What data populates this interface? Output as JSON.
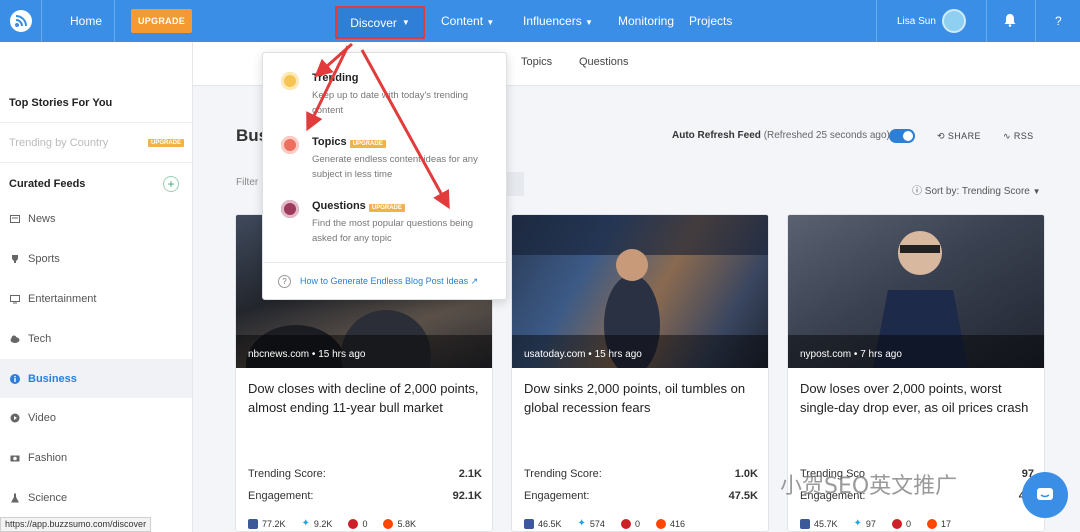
{
  "topnav": {
    "home": "Home",
    "upgrade": "UPGRADE",
    "discover": "Discover",
    "content": "Content",
    "influencers": "Influencers",
    "monitoring": "Monitoring",
    "projects": "Projects",
    "user_name": "Lisa Sun",
    "help": "?",
    "icons": [
      "buzzsumo-logo-icon",
      "chevron-down-icon",
      "avatar",
      "bell-icon",
      "help-icon"
    ]
  },
  "subnav": {
    "tabs": [
      "Topics",
      "Questions"
    ]
  },
  "sidebar": {
    "top_stories": "Top Stories For You",
    "trending_by_country": "Trending by Country",
    "upgrade_badge": "UPGRADE",
    "curated_feeds": "Curated Feeds",
    "add": "+",
    "items": [
      {
        "label": "News",
        "icon": "newspaper-icon"
      },
      {
        "label": "Sports",
        "icon": "trophy-icon"
      },
      {
        "label": "Entertainment",
        "icon": "tv-icon"
      },
      {
        "label": "Tech",
        "icon": "cloud-icon"
      },
      {
        "label": "Business",
        "icon": "info-icon",
        "active": true
      },
      {
        "label": "Video",
        "icon": "play-icon"
      },
      {
        "label": "Fashion",
        "icon": "camera-icon"
      },
      {
        "label": "Science",
        "icon": "flask-icon"
      }
    ]
  },
  "main": {
    "title": "Bus",
    "filter_label": "Filter",
    "auto_refresh_label": "Auto Refresh Feed",
    "refreshed": "(Refreshed 25 seconds ago)",
    "share": "SHARE",
    "rss": "RSS",
    "sort_by": "Sort by: Trending Score"
  },
  "cards": [
    {
      "source": "nbcnews.com • 15 hrs ago",
      "title": "Dow closes with decline of 2,000 points, almost ending 11-year bull market",
      "trending_label": "Trending Score:",
      "trending": "2.1K",
      "engagement_label": "Engagement:",
      "engagement": "92.1K",
      "facebook": "77.2K",
      "twitter": "9.2K",
      "pinterest": "0",
      "reddit": "5.8K"
    },
    {
      "source": "usatoday.com • 15 hrs ago",
      "title": "Dow sinks 2,000 points, oil tumbles on global recession fears",
      "trending_label": "Trending Score:",
      "trending": "1.0K",
      "engagement_label": "Engagement:",
      "engagement": "47.5K",
      "facebook": "46.5K",
      "twitter": "574",
      "pinterest": "0",
      "reddit": "416"
    },
    {
      "source": "nypost.com • 7 hrs ago",
      "title": "Dow loses over 2,000 points, worst single-day drop ever, as oil prices crash",
      "trending_label": "Trending Sco",
      "trending": "97",
      "engagement_label": "Engagement:",
      "engagement": "45.",
      "facebook": "45.7K",
      "twitter": "97",
      "pinterest": "0",
      "reddit": "17"
    }
  ],
  "dropdown": {
    "items": [
      {
        "title": "Trending",
        "desc": "Keep up to date with today's trending content",
        "upgrade": "",
        "color": "#f6c453"
      },
      {
        "title": "Topics",
        "desc": "Generate endless content ideas for any subject in less time",
        "upgrade": "UPGRADE",
        "color": "#ef6f5f"
      },
      {
        "title": "Questions",
        "desc": "Find the most popular questions being asked for any topic",
        "upgrade": "UPGRADE",
        "color": "#9c3b5c"
      }
    ],
    "footer_link": "How to Generate Endless Blog Post Ideas"
  },
  "status_url": "https://app.buzzsumo.com/discover",
  "watermark": "小贺SEO英文推广",
  "colors": {
    "nav": "#3a8ee6",
    "upgrade": "#f49a31",
    "accent": "#2c7ed6",
    "annotation": "#e23b3b"
  }
}
